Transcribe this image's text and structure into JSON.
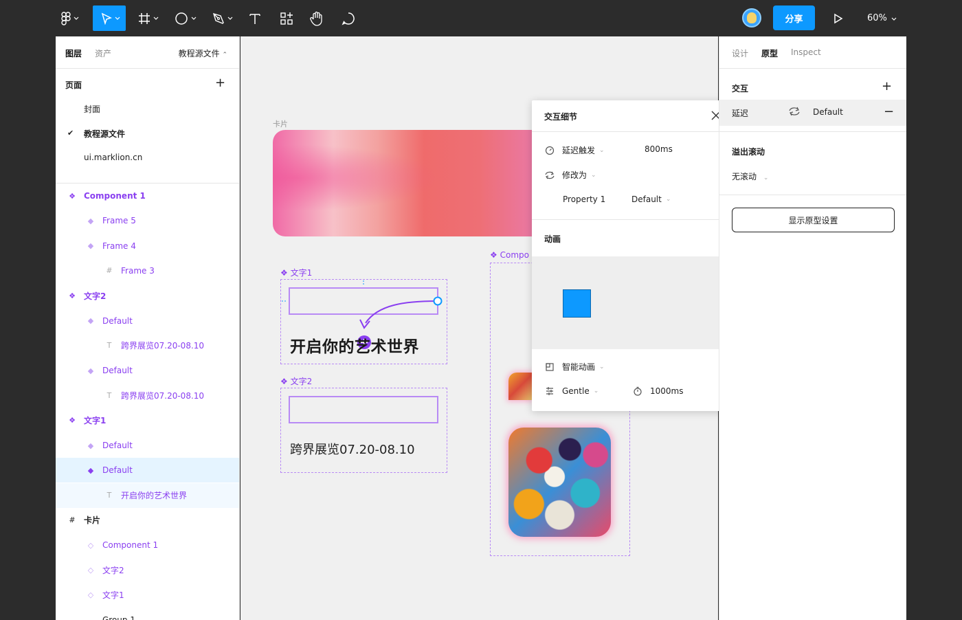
{
  "toolbar": {
    "share_label": "分享",
    "zoom_label": "60%",
    "tools": [
      "figma-menu-icon",
      "move-icon",
      "frame-icon",
      "ellipse-icon",
      "pen-icon",
      "text-icon",
      "components-icon",
      "hand-icon",
      "comment-icon"
    ]
  },
  "left_panel": {
    "tabs": [
      "图层",
      "资产"
    ],
    "current_file": "教程源文件",
    "pages_title": "页面",
    "pages": [
      {
        "label": "封面",
        "checked": false
      },
      {
        "label": "教程源文件",
        "checked": true
      },
      {
        "label": "ui.marklion.cn",
        "checked": false
      }
    ],
    "layers": [
      {
        "label": "Component 1",
        "icon": "component-set-icon",
        "indent": 0
      },
      {
        "label": "Frame 5",
        "icon": "variant-icon",
        "indent": 1
      },
      {
        "label": "Frame 4",
        "icon": "variant-icon",
        "indent": 1
      },
      {
        "label": "Frame 3",
        "icon": "frame-icon",
        "indent": 2
      },
      {
        "label": "文字2",
        "icon": "component-set-icon",
        "indent": 0
      },
      {
        "label": "Default",
        "icon": "variant-icon",
        "indent": 1
      },
      {
        "label": "跨界展览07.20-08.10",
        "icon": "text-icon",
        "indent": 2
      },
      {
        "label": "Default",
        "icon": "variant-icon",
        "indent": 1
      },
      {
        "label": "跨界展览07.20-08.10",
        "icon": "text-icon",
        "indent": 2
      },
      {
        "label": "文字1",
        "icon": "component-set-icon",
        "indent": 0
      },
      {
        "label": "Default",
        "icon": "variant-icon",
        "indent": 1
      },
      {
        "label": "Default",
        "icon": "variant-icon",
        "indent": 1
      },
      {
        "label": "开启你的艺术世界",
        "icon": "text-icon",
        "indent": 2
      },
      {
        "label": "卡片",
        "icon": "frame-icon",
        "indent": 0
      },
      {
        "label": "Component 1",
        "icon": "instance-icon",
        "indent": 1
      },
      {
        "label": "文字2",
        "icon": "instance-icon",
        "indent": 1
      },
      {
        "label": "文字1",
        "icon": "instance-icon",
        "indent": 1
      },
      {
        "label": "Group 1",
        "icon": "group-icon",
        "indent": 1
      }
    ]
  },
  "canvas": {
    "card_label": "卡片",
    "text1_label": "文字1",
    "text2_label": "文字2",
    "component_label": "Compo",
    "headline": "开启你的艺术世界",
    "subline": "跨界展览07.20-08.10"
  },
  "popup": {
    "title": "交互细节",
    "trigger_label": "延迟触发",
    "trigger_value": "800ms",
    "action_label": "修改为",
    "property_label": "Property 1",
    "property_value": "Default",
    "animation_title": "动画",
    "animation_type": "智能动画",
    "easing": "Gentle",
    "duration": "1000ms",
    "accent_color": "#0d99ff"
  },
  "right_panel": {
    "tabs": [
      "设计",
      "原型",
      "Inspect"
    ],
    "interaction_title": "交互",
    "delay_label": "延迟",
    "delay_value": "Default",
    "overflow_title": "溢出滚动",
    "overflow_value": "无滚动",
    "proto_button": "显示原型设置"
  }
}
